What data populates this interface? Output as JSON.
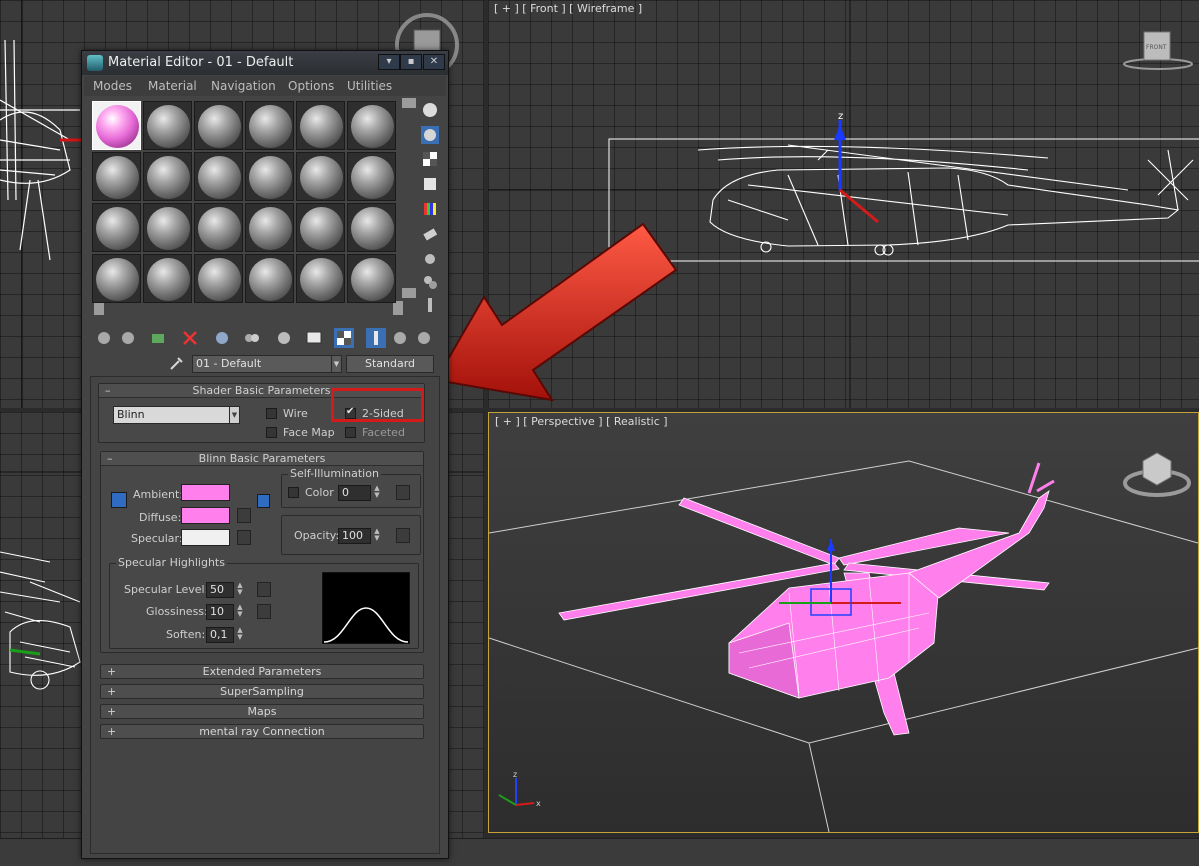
{
  "viewports": {
    "front_label": "[ + ] [ Front ] [ Wireframe ]",
    "perspective_label": "[ + ] [ Perspective ] [ Realistic ]",
    "viewcube_front": "FRONT",
    "axis_z": "z",
    "axis_x": "x"
  },
  "material_editor": {
    "title": "Material Editor - 01 - Default",
    "menu": [
      "Modes",
      "Material",
      "Navigation",
      "Options",
      "Utilities"
    ],
    "material_name": "01 - Default",
    "material_type": "Standard",
    "shader_rollout": {
      "title": "Shader Basic Parameters",
      "shader": "Blinn",
      "wire": "Wire",
      "two_sided": "2-Sided",
      "face_map": "Face Map",
      "faceted": "Faceted"
    },
    "blinn_rollout": {
      "title": "Blinn Basic Parameters",
      "self_illumination": "Self-Illumination",
      "color_label": "Color",
      "color_value": "0",
      "ambient": "Ambient:",
      "diffuse": "Diffuse:",
      "specular": "Specular:",
      "opacity_label": "Opacity:",
      "opacity_value": "100",
      "ambient_color": "#ff80ec",
      "diffuse_color": "#ff80ec",
      "specular_color": "#f0f0f0"
    },
    "specular_highlights": {
      "title": "Specular Highlights",
      "level_label": "Specular Level:",
      "level_value": "50",
      "gloss_label": "Glossiness:",
      "gloss_value": "10",
      "soften_label": "Soften:",
      "soften_value": "0,1"
    },
    "closed_rollouts": [
      "Extended Parameters",
      "SuperSampling",
      "Maps",
      "mental ray Connection"
    ]
  },
  "colors": {
    "highlight_box": "#d51a1a",
    "arrow": "#c01c12",
    "helicopter_material": "#ff80ec"
  }
}
